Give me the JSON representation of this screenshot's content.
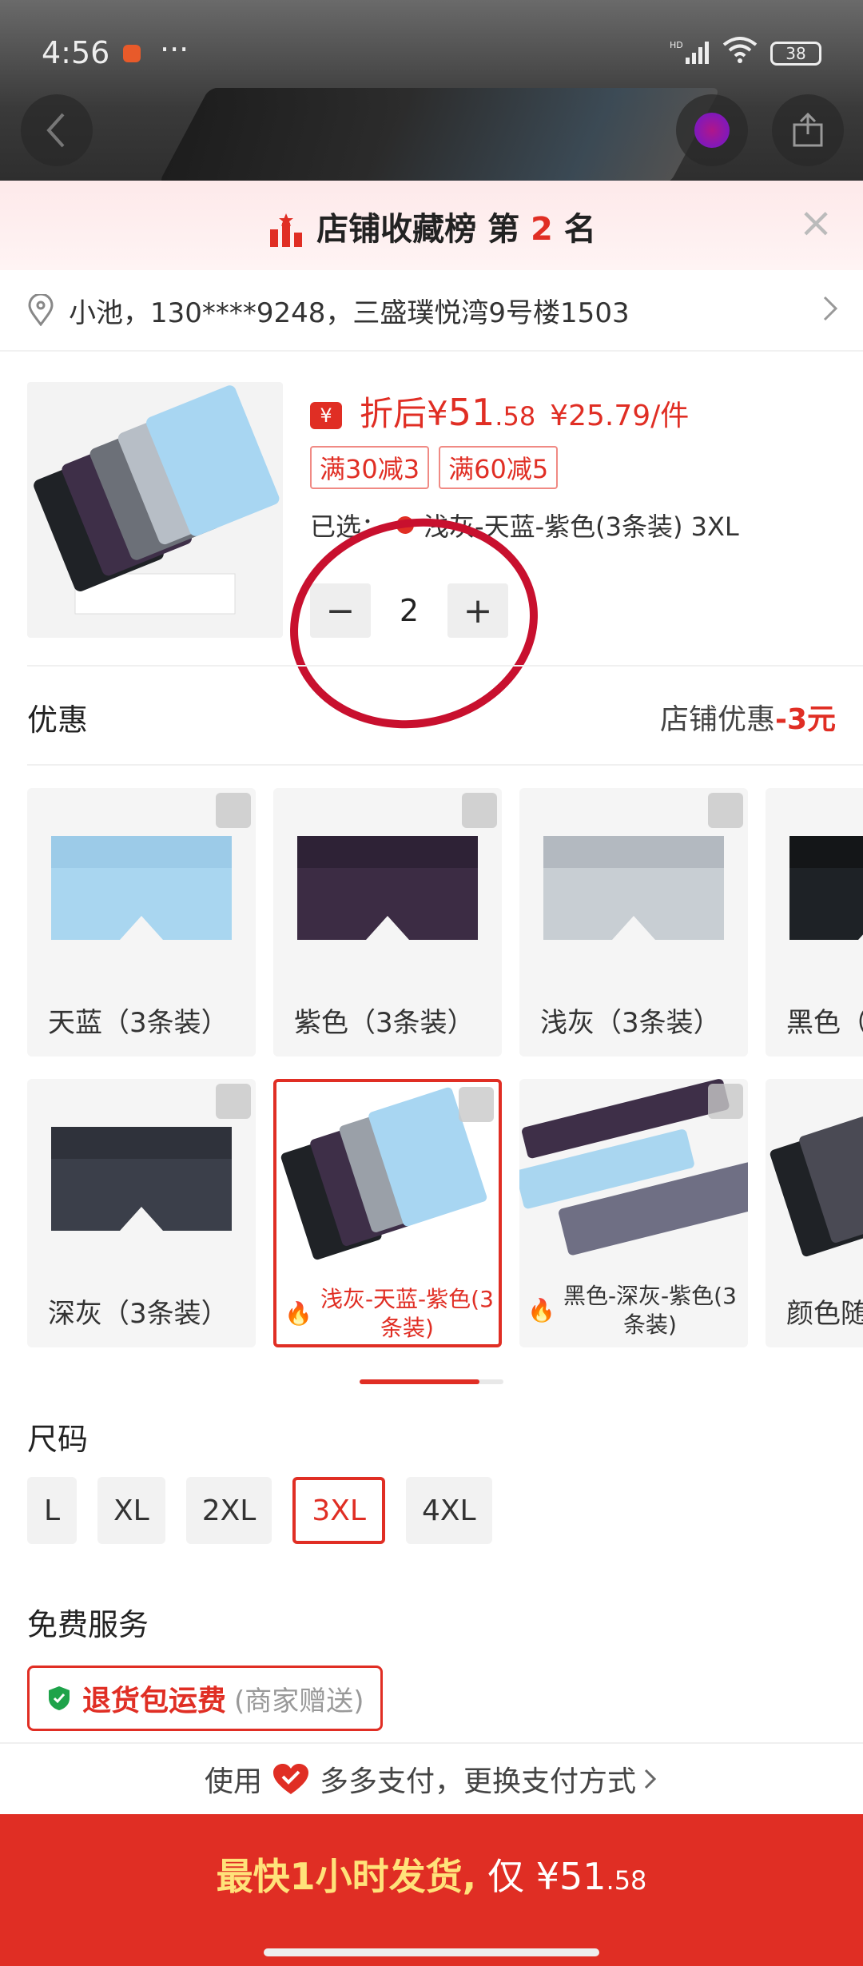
{
  "status_bar": {
    "time": "4:56",
    "dots": "···",
    "network": "HD",
    "battery": "38"
  },
  "rank_banner": {
    "prefix": "店铺收藏榜 第",
    "rank": "2",
    "suffix": "名"
  },
  "address": {
    "text": "小池，130****9248，三盛璞悦湾9号楼1503"
  },
  "product": {
    "price_label": "折后¥",
    "price_int": "51",
    "price_dec": ".58",
    "unit_price": "¥25.79/件",
    "tags": [
      "满30减3",
      "满60减5"
    ],
    "selected_prefix": "已选：",
    "selected_value": "浅灰-天蓝-紫色(3条装) 3XL",
    "quantity": "2",
    "minus": "−",
    "plus": "+"
  },
  "promo": {
    "label": "优惠",
    "right_prefix": "店铺优惠",
    "right_value": "-3元"
  },
  "variants": [
    {
      "label": "天蓝（3条装）",
      "color": "#a9d6f0"
    },
    {
      "label": "紫色（3条装）",
      "color": "#3c2c44"
    },
    {
      "label": "浅灰（3条装）",
      "color": "#c8ced3"
    },
    {
      "label": "黑色（",
      "color": "#1e2226"
    },
    {
      "label": "深灰（3条装）",
      "color": "#3b3f4a"
    },
    {
      "label": "浅灰-天蓝-紫色(3条装)",
      "color": "#9fd0ee"
    },
    {
      "label": "黑色-深灰-紫色(3条装)",
      "color": "#6f6f84"
    },
    {
      "label": "颜色随",
      "color": "#4a4a54"
    }
  ],
  "size": {
    "title": "尺码",
    "options": [
      "L",
      "XL",
      "2XL",
      "3XL",
      "4XL"
    ],
    "selected": "3XL"
  },
  "service": {
    "title": "免费服务",
    "name": "退货包运费",
    "note": "(商家赠送)"
  },
  "pay": {
    "prefix": "使用",
    "suffix": "多多支付，更换支付方式"
  },
  "buy": {
    "text": "最快1小时发货,",
    "prefix": "仅 ¥",
    "price_int": "51",
    "price_dec": ".58"
  }
}
